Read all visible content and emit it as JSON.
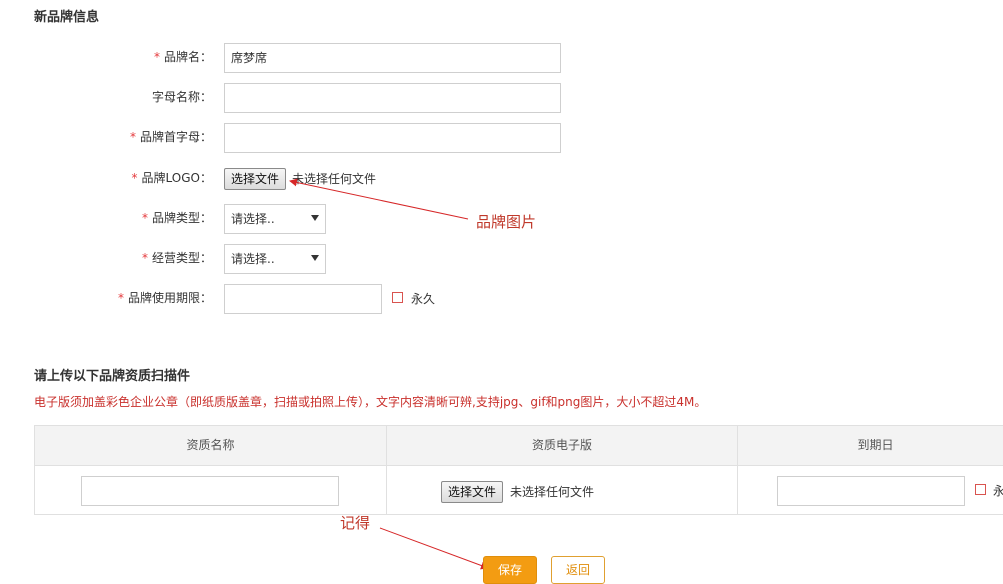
{
  "section1": {
    "title": "新品牌信息"
  },
  "form": {
    "brand_name": {
      "label": "品牌名：",
      "value": "席梦席"
    },
    "letter_name": {
      "label": "字母名称：",
      "value": ""
    },
    "initial": {
      "label": "品牌首字母：",
      "value": ""
    },
    "logo": {
      "label": "品牌LOGO：",
      "button": "选择文件",
      "status": "未选择任何文件"
    },
    "brand_type": {
      "label": "品牌类型：",
      "selected": "请选择.."
    },
    "business_type": {
      "label": "经营类型：",
      "selected": "请选择.."
    },
    "usage_period": {
      "label": "品牌使用期限：",
      "value": "",
      "permanent_label": "永久"
    },
    "required_mark": "*"
  },
  "section2": {
    "title": "请上传以下品牌资质扫描件",
    "note": "电子版须加盖彩色企业公章（即纸质版盖章，扫描或拍照上传），文字内容清晰可辨,支持jpg、gif和png图片，大小不超过4M。"
  },
  "table": {
    "headers": [
      "资质名称",
      "资质电子版",
      "到期日"
    ],
    "row": {
      "name_value": "",
      "file_button": "选择文件",
      "file_status": "未选择任何文件",
      "expiry_value": "",
      "permanent_label": "永"
    }
  },
  "annotations": {
    "logo_note": "品牌图片",
    "save_note": "记得"
  },
  "actions": {
    "save": "保存",
    "back": "返回"
  },
  "colors": {
    "required": "#e4393c",
    "note": "#c9302c",
    "annotation": "#c0392b",
    "save_button": "#f39c12"
  }
}
